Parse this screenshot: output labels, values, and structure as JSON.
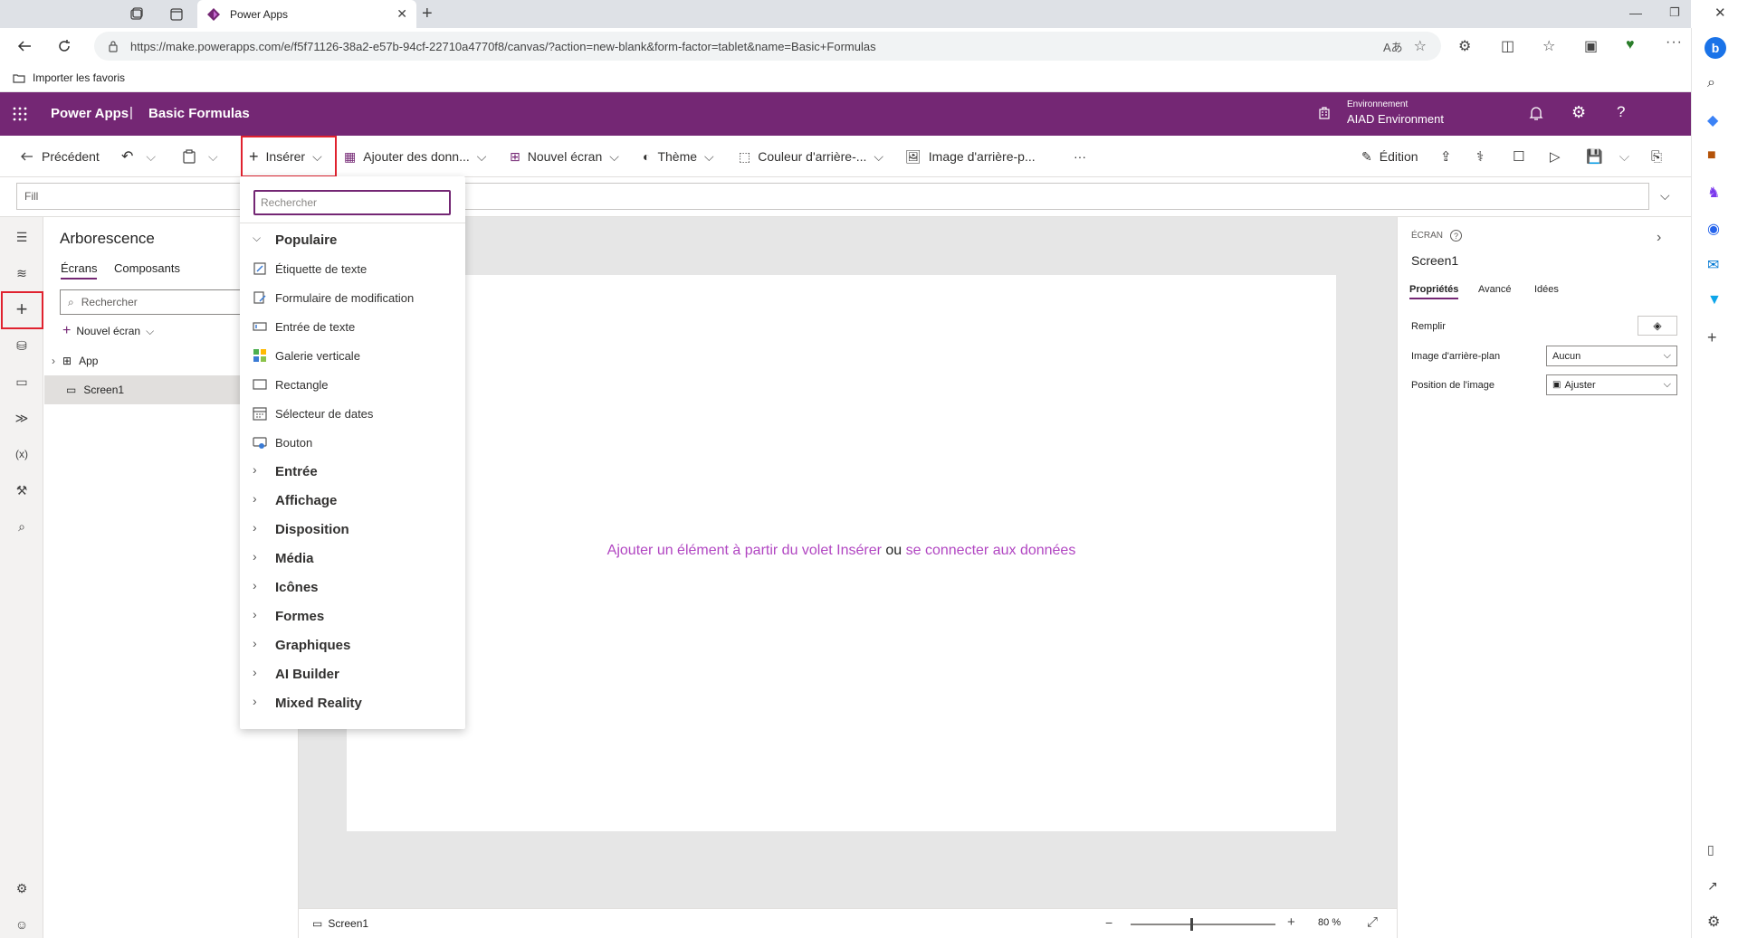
{
  "browser": {
    "tab_title": "Power Apps",
    "url": "https://make.powerapps.com/e/f5f71126-38a2-e57b-94cf-22710a4770f8/canvas/?action=new-blank&form-factor=tablet&name=Basic+Formulas",
    "favorites_label": "Importer les favoris"
  },
  "header": {
    "app_name": "Power Apps",
    "separator": "|",
    "doc_name": "Basic Formulas",
    "env_label": "Environnement",
    "env_name": "AIAD Environment"
  },
  "commandbar": {
    "back": "Précédent",
    "insert": "Insérer",
    "add_data": "Ajouter des donn...",
    "new_screen": "Nouvel écran",
    "theme": "Thème",
    "bg_color": "Couleur d'arrière-...",
    "bg_image": "Image d'arrière-p...",
    "more": "···",
    "edit": "Édition"
  },
  "formula": {
    "property": "Fill"
  },
  "tree": {
    "title": "Arborescence",
    "tabs": [
      "Écrans",
      "Composants"
    ],
    "search_placeholder": "Rechercher",
    "new_screen": "Nouvel écran",
    "items": [
      "App",
      "Screen1"
    ]
  },
  "insert_menu": {
    "search_placeholder": "Rechercher",
    "popular_label": "Populaire",
    "popular_items": [
      {
        "label": "Étiquette de texte",
        "icon": "text-label-icon"
      },
      {
        "label": "Formulaire de modification",
        "icon": "edit-form-icon"
      },
      {
        "label": "Entrée de texte",
        "icon": "text-input-icon"
      },
      {
        "label": "Galerie verticale",
        "icon": "gallery-icon"
      },
      {
        "label": "Rectangle",
        "icon": "rectangle-icon"
      },
      {
        "label": "Sélecteur de dates",
        "icon": "calendar-icon"
      },
      {
        "label": "Bouton",
        "icon": "button-icon"
      }
    ],
    "categories": [
      "Entrée",
      "Affichage",
      "Disposition",
      "Média",
      "Icônes",
      "Formes",
      "Graphiques",
      "AI Builder",
      "Mixed Reality"
    ]
  },
  "canvas": {
    "hint_link1": "Ajouter un élément à partir du volet Insérer",
    "hint_or": " ou ",
    "hint_link2": "se connecter aux données"
  },
  "status": {
    "screen": "Screen1",
    "zoom": "80",
    "zoom_unit": "%"
  },
  "properties": {
    "type_label": "ÉCRAN",
    "name": "Screen1",
    "tabs": [
      "Propriétés",
      "Avancé",
      "Idées"
    ],
    "fill_label": "Remplir",
    "bg_image_label": "Image d'arrière-plan",
    "bg_image_value": "Aucun",
    "img_pos_label": "Position de l'image",
    "img_pos_value": "Ajuster"
  },
  "colors": {
    "brand": "#742774",
    "link": "#b146c2",
    "highlight": "#e0222f"
  }
}
